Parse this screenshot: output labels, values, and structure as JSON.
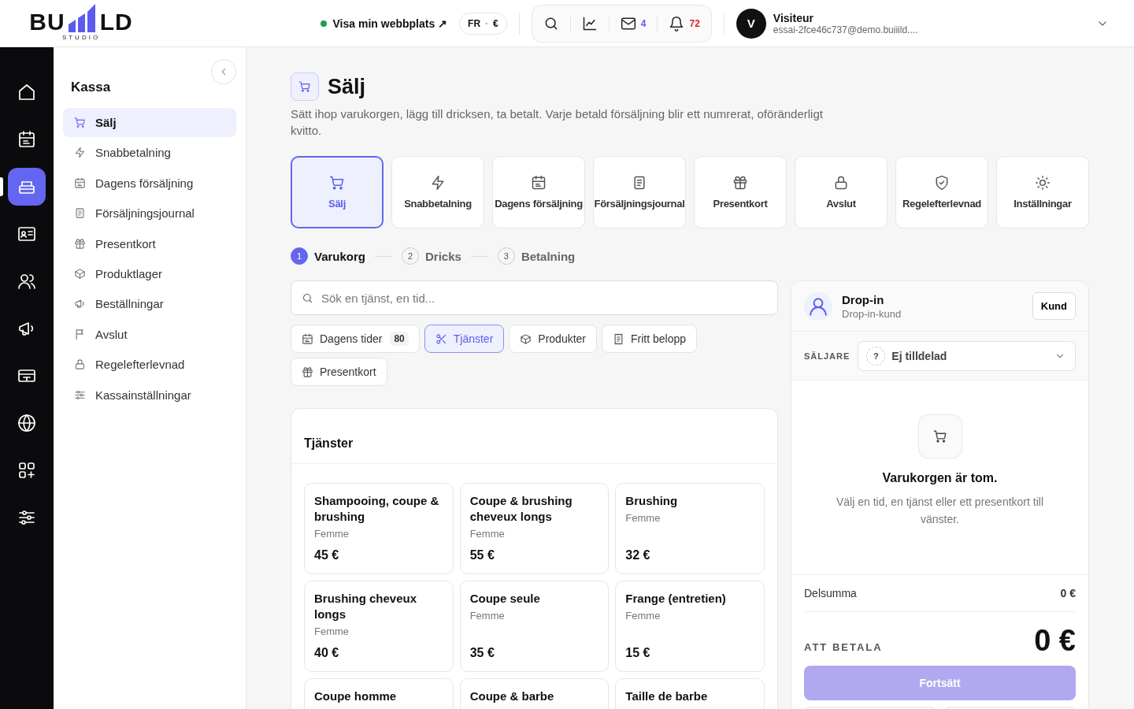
{
  "header": {
    "logo": {
      "left": "BU",
      "right": "LD",
      "tagline": "STUDIO"
    },
    "site_link": {
      "label": "Visa min webbplats ↗",
      "online": true
    },
    "locale": {
      "language": "FR",
      "separator": "·",
      "currency": "€"
    },
    "mail_count": "4",
    "notification_count": "72",
    "user": {
      "initial": "V",
      "name": "Visiteur",
      "email": "essai-2fce46c737@demo.buiiild...."
    }
  },
  "rail": [
    {
      "selected": false
    },
    {
      "selected": false
    },
    {
      "selected": true
    },
    {
      "selected": false
    },
    {
      "selected": false
    },
    {
      "selected": false
    },
    {
      "selected": false
    },
    {
      "selected": false
    },
    {
      "selected": false
    },
    {
      "selected": false
    }
  ],
  "sidebar": {
    "title": "Kassa",
    "items": [
      {
        "label": "Sälj",
        "selected": true
      },
      {
        "label": "Snabbetalning",
        "selected": false
      },
      {
        "label": "Dagens försäljning",
        "selected": false
      },
      {
        "label": "Försäljningsjournal",
        "selected": false
      },
      {
        "label": "Presentkort",
        "selected": false
      },
      {
        "label": "Produktlager",
        "selected": false
      },
      {
        "label": "Beställningar",
        "selected": false
      },
      {
        "label": "Avslut",
        "selected": false
      },
      {
        "label": "Regelefterlevnad",
        "selected": false
      },
      {
        "label": "Kassainställningar",
        "selected": false
      }
    ]
  },
  "page": {
    "title": "Sälj",
    "description": "Sätt ihop varukorgen, lägg till dricksen, ta betalt. Varje betald försäljning blir ett numrerat, oföränderligt kvitto.",
    "tiles": [
      {
        "label": "Sälj",
        "selected": true
      },
      {
        "label": "Snabbetalning",
        "selected": false
      },
      {
        "label": "Dagens försäljning",
        "selected": false
      },
      {
        "label": "Försäljningsjournal",
        "selected": false
      },
      {
        "label": "Presentkort",
        "selected": false
      },
      {
        "label": "Avslut",
        "selected": false
      },
      {
        "label": "Regelefterlevnad",
        "selected": false
      },
      {
        "label": "Inställningar",
        "selected": false
      }
    ],
    "steps": [
      {
        "number": "1",
        "label": "Varukorg",
        "selected": true
      },
      {
        "number": "2",
        "label": "Dricks",
        "selected": false
      },
      {
        "number": "3",
        "label": "Betalning",
        "selected": false
      }
    ],
    "search": {
      "placeholder": "Sök en tjänst, en tid..."
    },
    "chips": [
      {
        "label": "Dagens tider",
        "count": "80",
        "selected": false
      },
      {
        "label": "Tjänster",
        "selected": true
      },
      {
        "label": "Produkter",
        "selected": false
      },
      {
        "label": "Fritt belopp",
        "selected": false
      },
      {
        "label": "Presentkort",
        "selected": false
      }
    ],
    "services": {
      "title": "Tjänster",
      "items": [
        {
          "name": "Shampooing, coupe & brushing",
          "category": "Femme",
          "price": "45 €"
        },
        {
          "name": "Coupe & brushing cheveux longs",
          "category": "Femme",
          "price": "55 €"
        },
        {
          "name": "Brushing",
          "category": "Femme",
          "price": "32 €"
        },
        {
          "name": "Brushing cheveux longs",
          "category": "Femme",
          "price": "40 €"
        },
        {
          "name": "Coupe seule",
          "category": "Femme",
          "price": "35 €"
        },
        {
          "name": "Frange (entretien)",
          "category": "Femme",
          "price": "15 €"
        },
        {
          "name": "Coupe homme"
        },
        {
          "name": "Coupe & barbe"
        },
        {
          "name": "Taille de barbe"
        }
      ]
    }
  },
  "cart": {
    "customer": {
      "name": "Drop-in",
      "type": "Drop-in-kund",
      "button": "Kund"
    },
    "seller": {
      "label": "SÄLJARE",
      "badge": "?",
      "value": "Ej tilldelad"
    },
    "empty": {
      "title": "Varukorgen är tom.",
      "hint": "Välj en tid, en tjänst eller ett presentkort till vänster."
    },
    "subtotal": {
      "label": "Delsumma",
      "value": "0 €"
    },
    "total": {
      "label": "ATT BETALA",
      "value": "0 €"
    },
    "primary_button": {
      "label": "Fortsätt",
      "disabled": true
    }
  }
}
